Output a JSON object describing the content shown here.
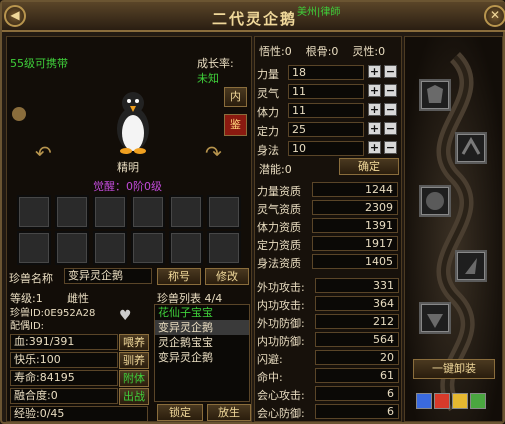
{
  "window": {
    "title": "二代灵企鹅"
  },
  "left": {
    "level_text": "55级可携带",
    "growth_label": "成长率:",
    "growth_value": "未知",
    "inner_btn": "内",
    "appraise_btn": "鉴",
    "personality": "精明",
    "awaken": "觉醒：0阶0级",
    "name_label": "珍兽名称",
    "name_value": "变异灵企鹅",
    "title_btn": "称号",
    "modify_btn": "修改",
    "level_label": "等级:1",
    "gender": "雌性",
    "pet_id": "珍兽ID:0E952A28",
    "mate_id": "配偶ID:",
    "hp": "血:391/391",
    "happy": "快乐:100",
    "life": "寿命:84195",
    "fusion": "融合度:0",
    "exp": "经验:0/45",
    "feed_btn": "喂养",
    "tame_btn": "驯养",
    "attach_btn": "附体",
    "battle_btn": "出战",
    "lock_btn": "锁定",
    "release_btn": "放生",
    "list_title": "珍兽列表 4/4",
    "pet_list": [
      "花仙子宝宝",
      "变异灵企鹅",
      "灵企鹅宝宝",
      "变异灵企鹅"
    ]
  },
  "mid": {
    "top_stats": "悟性:0    根骨:0    灵性:0",
    "stats": [
      {
        "name": "力量",
        "value": "18"
      },
      {
        "name": "灵气",
        "value": "11"
      },
      {
        "name": "体力",
        "value": "11"
      },
      {
        "name": "定力",
        "value": "25"
      },
      {
        "name": "身法",
        "value": "10"
      }
    ],
    "potential": "潜能:0",
    "confirm_btn": "确定",
    "aptitudes": [
      {
        "name": "力量资质",
        "value": "1244"
      },
      {
        "name": "灵气资质",
        "value": "2309"
      },
      {
        "name": "体力资质",
        "value": "1391"
      },
      {
        "name": "定力资质",
        "value": "1917"
      },
      {
        "name": "身法资质",
        "value": "1405"
      }
    ],
    "combat": [
      {
        "name": "外功攻击:",
        "value": "331"
      },
      {
        "name": "内功攻击:",
        "value": "364"
      },
      {
        "name": "外功防御:",
        "value": "212"
      },
      {
        "name": "内功防御:",
        "value": "564"
      },
      {
        "name": "闪避:",
        "value": "20"
      },
      {
        "name": "命中:",
        "value": "61"
      },
      {
        "name": "会心攻击:",
        "value": "6"
      },
      {
        "name": "会心防御:",
        "value": "6"
      }
    ]
  },
  "right": {
    "unequip_btn": "一键卸装"
  },
  "top_hint": "美州|律師",
  "colors": {
    "accent": "#f0d89a",
    "green": "#3fcf3a",
    "purple": "#c04ad8",
    "border": "#8a6d3c"
  }
}
